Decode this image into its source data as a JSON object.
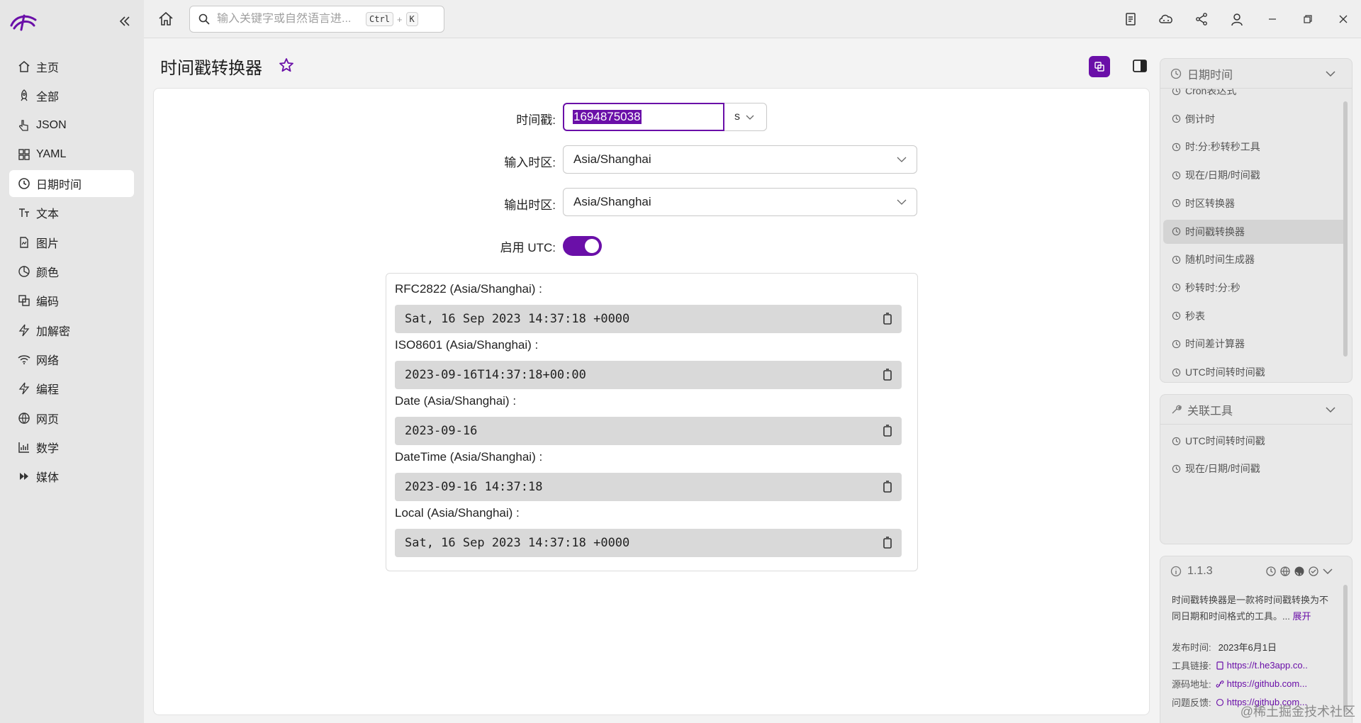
{
  "sidebar": {
    "items": [
      {
        "label": "主页",
        "icon": "home-icon"
      },
      {
        "label": "全部",
        "icon": "rocket-icon"
      },
      {
        "label": "JSON",
        "icon": "pointer-icon"
      },
      {
        "label": "YAML",
        "icon": "grid-icon"
      },
      {
        "label": "日期时间",
        "icon": "clock-icon",
        "active": true
      },
      {
        "label": "文本",
        "icon": "text-icon"
      },
      {
        "label": "图片",
        "icon": "image-icon"
      },
      {
        "label": "颜色",
        "icon": "palette-icon"
      },
      {
        "label": "编码",
        "icon": "encode-icon"
      },
      {
        "label": "加解密",
        "icon": "bolt-icon"
      },
      {
        "label": "网络",
        "icon": "wifi-icon"
      },
      {
        "label": "编程",
        "icon": "code-icon"
      },
      {
        "label": "网页",
        "icon": "globe-icon"
      },
      {
        "label": "数学",
        "icon": "chart-icon"
      },
      {
        "label": "媒体",
        "icon": "media-icon"
      }
    ]
  },
  "topbar": {
    "search_placeholder": "输入关键字或自然语言进...",
    "kbd_ctrl": "Ctrl",
    "kbd_plus": "+",
    "kbd_k": "K"
  },
  "main": {
    "title": "时间戳转换器",
    "timestamp_label": "时间戳:",
    "timestamp_value": "1694875038",
    "unit_value": "s",
    "input_tz_label": "输入时区:",
    "input_tz_value": "Asia/Shanghai",
    "output_tz_label": "输出时区:",
    "output_tz_value": "Asia/Shanghai",
    "utc_label": "启用 UTC:",
    "utc_enabled": true,
    "results": [
      {
        "label": "RFC2822 (Asia/Shanghai) :",
        "value": "Sat, 16 Sep 2023 14:37:18 +0000"
      },
      {
        "label": "ISO8601 (Asia/Shanghai) :",
        "value": "2023-09-16T14:37:18+00:00"
      },
      {
        "label": "Date (Asia/Shanghai) :",
        "value": "2023-09-16"
      },
      {
        "label": "DateTime (Asia/Shanghai) :",
        "value": "2023-09-16 14:37:18"
      },
      {
        "label": "Local (Asia/Shanghai) :",
        "value": "Sat, 16 Sep 2023 14:37:18 +0000"
      }
    ]
  },
  "right_panel": {
    "category_title": "日期时间",
    "category_items": [
      "Cron表达式",
      "倒计时",
      "时:分:秒转秒工具",
      "现在/日期/时间戳",
      "时区转换器",
      "时间戳转换器",
      "随机时间生成器",
      "秒转时:分:秒",
      "秒表",
      "时间差计算器",
      "UTC时间转时间戳"
    ],
    "active_item": "时间戳转换器",
    "related_title": "关联工具",
    "related_items": [
      "UTC时间转时间戳",
      "现在/日期/时间戳"
    ],
    "info": {
      "version": "1.1.3",
      "description": "时间戳转换器是一款将时间戳转换为不同日期和时间格式的工具。...",
      "expand": "展开",
      "release_label": "发布时间:",
      "release_value": "2023年6月1日",
      "tool_link_label": "工具链接:",
      "tool_link_value": "https://t.he3app.co..",
      "source_label": "源码地址:",
      "source_value": "https://github.com...",
      "feedback_label": "问题反馈:",
      "feedback_value": "https://github.com..."
    }
  },
  "watermark": "@稀土掘金技术社区",
  "colors": {
    "accent": "#6a0fa8",
    "sidebar_bg": "#e6e6e6",
    "result_bg": "#d9d9d9"
  }
}
